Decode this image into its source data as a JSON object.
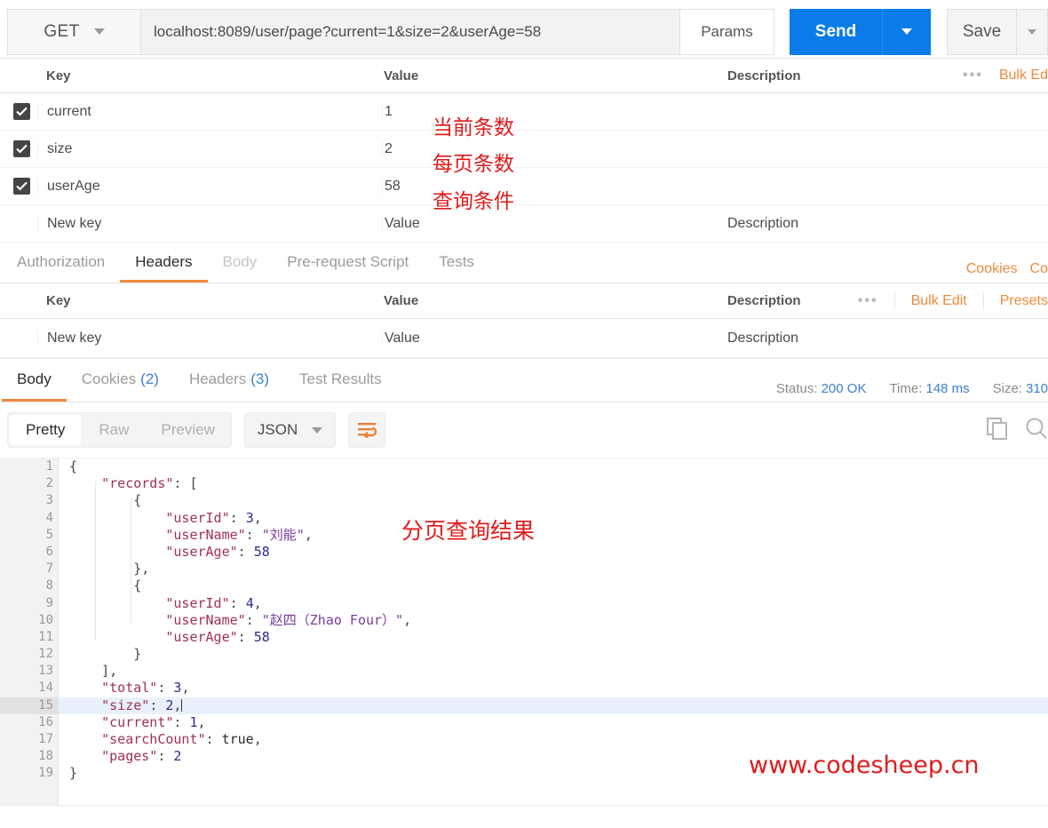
{
  "request": {
    "method": "GET",
    "url": "localhost:8089/user/page?current=1&size=2&userAge=58",
    "params_label": "Params",
    "send_label": "Send",
    "save_label": "Save"
  },
  "params_table": {
    "headers": {
      "key": "Key",
      "value": "Value",
      "description": "Description"
    },
    "actions": {
      "dots": "•••",
      "bulk_edit": "Bulk Ed"
    },
    "rows": [
      {
        "checked": true,
        "key": "current",
        "value": "1",
        "description": "",
        "note": "当前条数"
      },
      {
        "checked": true,
        "key": "size",
        "value": "2",
        "description": "",
        "note": "每页条数"
      },
      {
        "checked": true,
        "key": "userAge",
        "value": "58",
        "description": "",
        "note": "查询条件"
      }
    ],
    "new_row": {
      "key_placeholder": "New key",
      "value_placeholder": "Value",
      "description_placeholder": "Description"
    }
  },
  "request_tabs": {
    "items": [
      {
        "label": "Authorization",
        "state": "normal"
      },
      {
        "label": "Headers",
        "state": "active"
      },
      {
        "label": "Body",
        "state": "dim"
      },
      {
        "label": "Pre-request Script",
        "state": "normal"
      },
      {
        "label": "Tests",
        "state": "normal"
      }
    ],
    "right_links": [
      "Cookies",
      "Co"
    ]
  },
  "headers_table": {
    "headers": {
      "key": "Key",
      "value": "Value",
      "description": "Description"
    },
    "actions": {
      "dots": "•••",
      "bulk_edit": "Bulk Edit",
      "presets": "Presets"
    },
    "new_row": {
      "key_placeholder": "New key",
      "value_placeholder": "Value",
      "description_placeholder": "Description"
    }
  },
  "response_tabs": {
    "items": [
      {
        "label": "Body",
        "count": "",
        "state": "active"
      },
      {
        "label": "Cookies",
        "count": "(2)",
        "state": "normal"
      },
      {
        "label": "Headers",
        "count": "(3)",
        "state": "normal"
      },
      {
        "label": "Test Results",
        "count": "",
        "state": "normal"
      }
    ],
    "meta": {
      "status_label": "Status:",
      "status_value": "200 OK",
      "time_label": "Time:",
      "time_value": "148 ms",
      "size_label": "Size:",
      "size_value": "310"
    }
  },
  "format_bar": {
    "modes": [
      {
        "label": "Pretty",
        "state": "active"
      },
      {
        "label": "Raw",
        "state": "normal"
      },
      {
        "label": "Preview",
        "state": "normal"
      }
    ],
    "language": "JSON",
    "icons": {
      "wrap": "word-wrap-icon",
      "copy": "copy-icon",
      "search": "search-icon"
    }
  },
  "response_body": {
    "lines": [
      {
        "no": "1",
        "fold": true,
        "indent": 0,
        "tokens": [
          {
            "t": "{",
            "c": "p"
          }
        ]
      },
      {
        "no": "2",
        "fold": true,
        "indent": 1,
        "tokens": [
          {
            "t": "\"records\"",
            "c": "k"
          },
          {
            "t": ": [",
            "c": "p"
          }
        ]
      },
      {
        "no": "3",
        "fold": true,
        "indent": 2,
        "tokens": [
          {
            "t": "{",
            "c": "p"
          }
        ]
      },
      {
        "no": "4",
        "fold": false,
        "indent": 3,
        "tokens": [
          {
            "t": "\"userId\"",
            "c": "k"
          },
          {
            "t": ": ",
            "c": "p"
          },
          {
            "t": "3",
            "c": "n"
          },
          {
            "t": ",",
            "c": "p"
          }
        ]
      },
      {
        "no": "5",
        "fold": false,
        "indent": 3,
        "tokens": [
          {
            "t": "\"userName\"",
            "c": "k"
          },
          {
            "t": ": ",
            "c": "p"
          },
          {
            "t": "\"刘能\"",
            "c": "s"
          },
          {
            "t": ",",
            "c": "p"
          }
        ]
      },
      {
        "no": "6",
        "fold": false,
        "indent": 3,
        "tokens": [
          {
            "t": "\"userAge\"",
            "c": "k"
          },
          {
            "t": ": ",
            "c": "p"
          },
          {
            "t": "58",
            "c": "n"
          }
        ]
      },
      {
        "no": "7",
        "fold": false,
        "indent": 2,
        "tokens": [
          {
            "t": "},",
            "c": "p"
          }
        ]
      },
      {
        "no": "8",
        "fold": true,
        "indent": 2,
        "tokens": [
          {
            "t": "{",
            "c": "p"
          }
        ]
      },
      {
        "no": "9",
        "fold": false,
        "indent": 3,
        "tokens": [
          {
            "t": "\"userId\"",
            "c": "k"
          },
          {
            "t": ": ",
            "c": "p"
          },
          {
            "t": "4",
            "c": "n"
          },
          {
            "t": ",",
            "c": "p"
          }
        ]
      },
      {
        "no": "10",
        "fold": false,
        "indent": 3,
        "tokens": [
          {
            "t": "\"userName\"",
            "c": "k"
          },
          {
            "t": ": ",
            "c": "p"
          },
          {
            "t": "\"赵四（Zhao Four）\"",
            "c": "s"
          },
          {
            "t": ",",
            "c": "p"
          }
        ]
      },
      {
        "no": "11",
        "fold": false,
        "indent": 3,
        "tokens": [
          {
            "t": "\"userAge\"",
            "c": "k"
          },
          {
            "t": ": ",
            "c": "p"
          },
          {
            "t": "58",
            "c": "n"
          }
        ]
      },
      {
        "no": "12",
        "fold": false,
        "indent": 2,
        "tokens": [
          {
            "t": "}",
            "c": "p"
          }
        ]
      },
      {
        "no": "13",
        "fold": false,
        "indent": 1,
        "tokens": [
          {
            "t": "],",
            "c": "p"
          }
        ]
      },
      {
        "no": "14",
        "fold": false,
        "indent": 1,
        "tokens": [
          {
            "t": "\"total\"",
            "c": "k"
          },
          {
            "t": ": ",
            "c": "p"
          },
          {
            "t": "3",
            "c": "n"
          },
          {
            "t": ",",
            "c": "p"
          }
        ]
      },
      {
        "no": "15",
        "fold": false,
        "indent": 1,
        "highlight": true,
        "cursor": true,
        "tokens": [
          {
            "t": "\"size\"",
            "c": "k"
          },
          {
            "t": ": ",
            "c": "p"
          },
          {
            "t": "2",
            "c": "n"
          },
          {
            "t": ",",
            "c": "p"
          }
        ]
      },
      {
        "no": "16",
        "fold": false,
        "indent": 1,
        "tokens": [
          {
            "t": "\"current\"",
            "c": "k"
          },
          {
            "t": ": ",
            "c": "p"
          },
          {
            "t": "1",
            "c": "n"
          },
          {
            "t": ",",
            "c": "p"
          }
        ]
      },
      {
        "no": "17",
        "fold": false,
        "indent": 1,
        "tokens": [
          {
            "t": "\"searchCount\"",
            "c": "k"
          },
          {
            "t": ": ",
            "c": "p"
          },
          {
            "t": "true",
            "c": "b"
          },
          {
            "t": ",",
            "c": "p"
          }
        ]
      },
      {
        "no": "18",
        "fold": false,
        "indent": 1,
        "tokens": [
          {
            "t": "\"pages\"",
            "c": "k"
          },
          {
            "t": ": ",
            "c": "p"
          },
          {
            "t": "2",
            "c": "n"
          }
        ]
      },
      {
        "no": "19",
        "fold": false,
        "indent": 0,
        "tokens": [
          {
            "t": "}",
            "c": "p"
          }
        ]
      }
    ]
  },
  "annotations": {
    "result_note": "分页查询结果",
    "watermark": "www.codesheep.cn",
    "color": "#e01b1b"
  }
}
